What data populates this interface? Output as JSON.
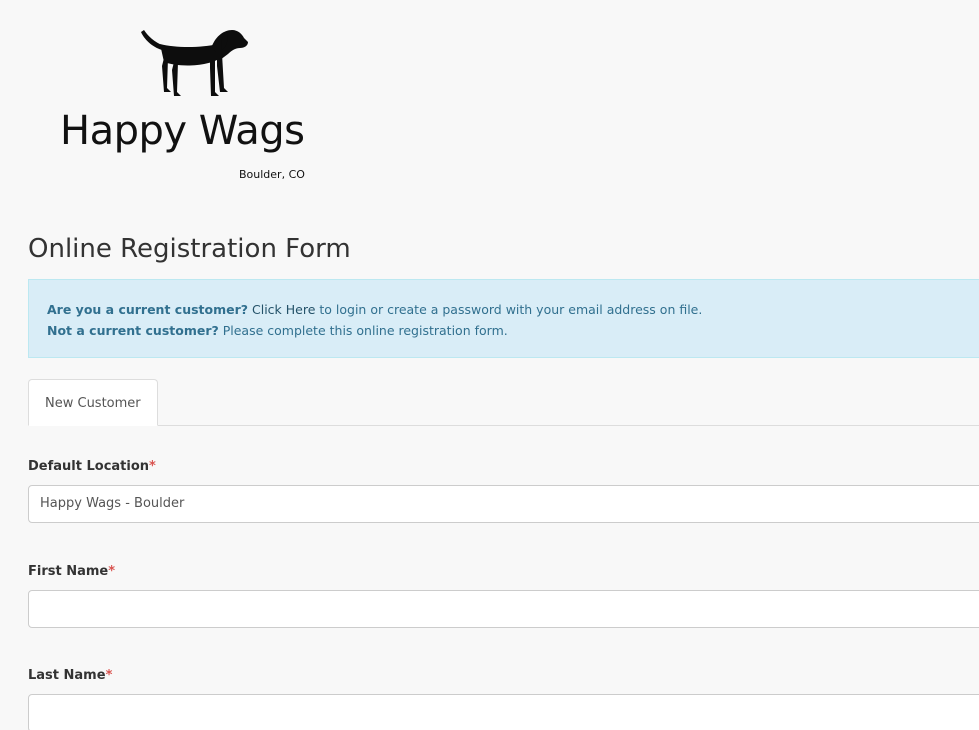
{
  "branding": {
    "name": "Happy Wags",
    "location": "Boulder, CO",
    "logo_icon": "dog-silhouette-icon"
  },
  "page": {
    "title": "Online Registration Form"
  },
  "alert": {
    "line1_bold": "Are you a current customer?",
    "line1_link": "Click Here",
    "line1_rest": " to login or create a password with your email address on file.",
    "line2_bold": "Not a current customer?",
    "line2_rest": " Please complete this online registration form."
  },
  "tabs": [
    {
      "label": "New Customer",
      "active": true
    }
  ],
  "form": {
    "required_marker": "*",
    "default_location": {
      "label": "Default Location",
      "value": "Happy Wags - Boulder"
    },
    "first_name": {
      "label": "First Name",
      "value": ""
    },
    "last_name": {
      "label": "Last Name",
      "value": ""
    }
  },
  "colors": {
    "alert_bg": "#d9edf7",
    "alert_text": "#31708f",
    "required": "#d9534f"
  }
}
